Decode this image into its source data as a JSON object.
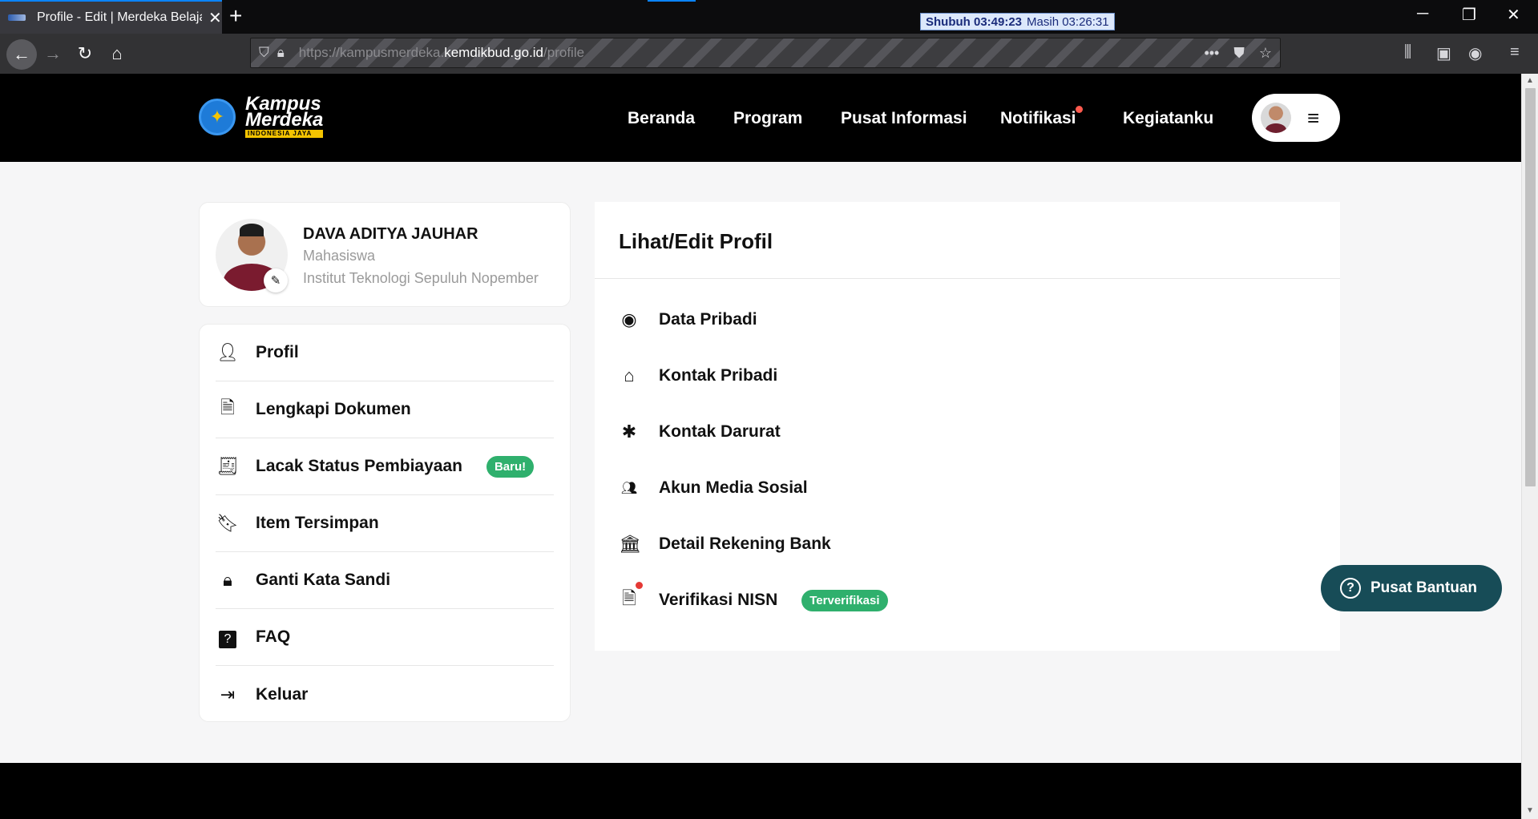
{
  "browser": {
    "tab_title": "Profile - Edit | Merdeka Belajar",
    "tab_close": "✕",
    "new_tab": "+",
    "prayer_name": "Shubuh 03:49:23",
    "prayer_remaining": "Masih 03:26:31",
    "url_prefix": "https://kampusmerdeka.",
    "url_domain": "kemdikbud.go.id",
    "url_path": "/profile"
  },
  "header": {
    "logo_line1": "Kampus",
    "logo_line2": "Merdeka",
    "logo_sub": "INDONESIA JAYA",
    "nav": [
      "Beranda",
      "Program",
      "Pusat Informasi",
      "Notifikasi",
      "Kegiatanku"
    ]
  },
  "profile": {
    "name": "DAVA ADITYA JAUHAR",
    "role": "Mahasiswa",
    "university": "Institut Teknologi Sepuluh Nopember"
  },
  "side_menu": {
    "items": [
      {
        "label": "Profil",
        "icon": "user-gear-icon"
      },
      {
        "label": "Lengkapi Dokumen",
        "icon": "document-icon"
      },
      {
        "label": "Lacak Status Pembiayaan",
        "icon": "receipt-icon",
        "badge": "Baru!"
      },
      {
        "label": "Item Tersimpan",
        "icon": "bookmark-icon"
      },
      {
        "label": "Ganti Kata Sandi",
        "icon": "lock-icon"
      },
      {
        "label": "FAQ",
        "icon": "question-icon"
      },
      {
        "label": "Keluar",
        "icon": "logout-icon"
      }
    ]
  },
  "edit_panel": {
    "title": "Lihat/Edit Profil",
    "items": [
      {
        "label": "Data Pribadi",
        "icon": "user-circle-icon"
      },
      {
        "label": "Kontak Pribadi",
        "icon": "home-icon"
      },
      {
        "label": "Kontak Darurat",
        "icon": "asterisk-icon"
      },
      {
        "label": "Akun Media Sosial",
        "icon": "people-icon"
      },
      {
        "label": "Detail Rekening Bank",
        "icon": "bank-icon"
      },
      {
        "label": "Verifikasi NISN",
        "icon": "document-alert-icon",
        "badge": "Terverifikasi"
      }
    ]
  },
  "help": {
    "label": "Pusat Bantuan"
  },
  "colors": {
    "accent_green": "#2fb06d",
    "help_bg": "#174c57",
    "notif_dot": "#ff5a4e"
  }
}
